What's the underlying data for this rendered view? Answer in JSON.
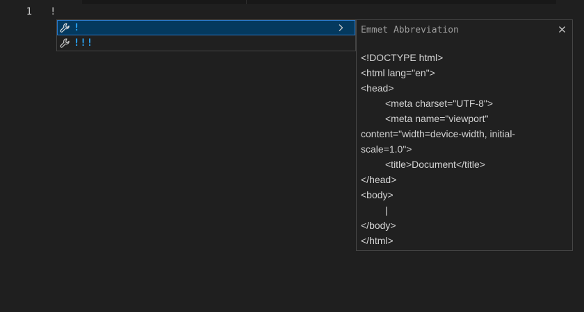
{
  "editor": {
    "line_number": "1",
    "line_text": "!"
  },
  "suggestions": {
    "items": [
      {
        "label": "!",
        "icon": "wrench-icon",
        "selected": true
      },
      {
        "label": "!!!",
        "icon": "wrench-icon",
        "selected": false
      }
    ],
    "details_chevron_icon": "chevron-right-icon"
  },
  "details": {
    "title": "Emmet Abbreviation",
    "close_glyph": "×",
    "lines": [
      {
        "indent": 0,
        "text": "<!DOCTYPE html>"
      },
      {
        "indent": 0,
        "text": "<html lang=\"en\">"
      },
      {
        "indent": 0,
        "text": "<head>"
      },
      {
        "indent": 1,
        "text": "<meta charset=\"UTF-8\">"
      },
      {
        "indent": 1,
        "text": "<meta name=\"viewport\""
      },
      {
        "indent": 0,
        "text": "content=\"width=device-width, initial-"
      },
      {
        "indent": 0,
        "text": "scale=1.0\">"
      },
      {
        "indent": 1,
        "text": "<title>Document</title>"
      },
      {
        "indent": 0,
        "text": "</head>"
      },
      {
        "indent": 0,
        "text": "<body>"
      },
      {
        "indent": 1,
        "text": "|"
      },
      {
        "indent": 0,
        "text": "</body>"
      },
      {
        "indent": 0,
        "text": "</html>"
      }
    ]
  },
  "colors": {
    "background": "#1f1f1f",
    "selected_row": "#04395e",
    "label_accent": "#2aaaff"
  }
}
